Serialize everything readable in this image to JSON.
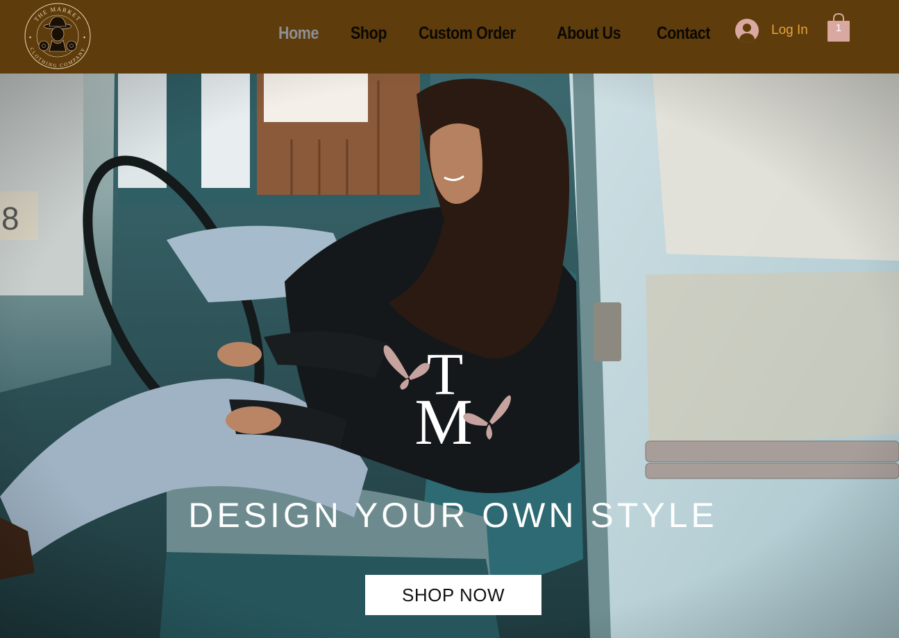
{
  "brand": {
    "logo_text_top": "THE MARKET",
    "logo_text_bottom": "CLOTHING COMPANY",
    "icon": "cowboy-logo-icon"
  },
  "nav": {
    "items": [
      {
        "label": "Home",
        "active": true
      },
      {
        "label": "Shop",
        "active": false
      },
      {
        "label": "Custom Order",
        "active": false
      },
      {
        "label": "About Us",
        "active": false
      },
      {
        "label": "Contact",
        "active": false
      }
    ]
  },
  "account": {
    "login_label": "Log In",
    "icon": "user-avatar-icon"
  },
  "cart": {
    "count": "1",
    "icon": "shopping-bag-icon"
  },
  "hero": {
    "monogram": "TM",
    "tagline": "DESIGN YOUR OWN STYLE",
    "cta_label": "SHOP NOW"
  },
  "colors": {
    "header_bg": "#5e3c0c",
    "nav_text": "#0c0903",
    "nav_active": "#8c8f94",
    "login_text": "#e6a33c",
    "accent_pink": "#d9a8a1"
  }
}
